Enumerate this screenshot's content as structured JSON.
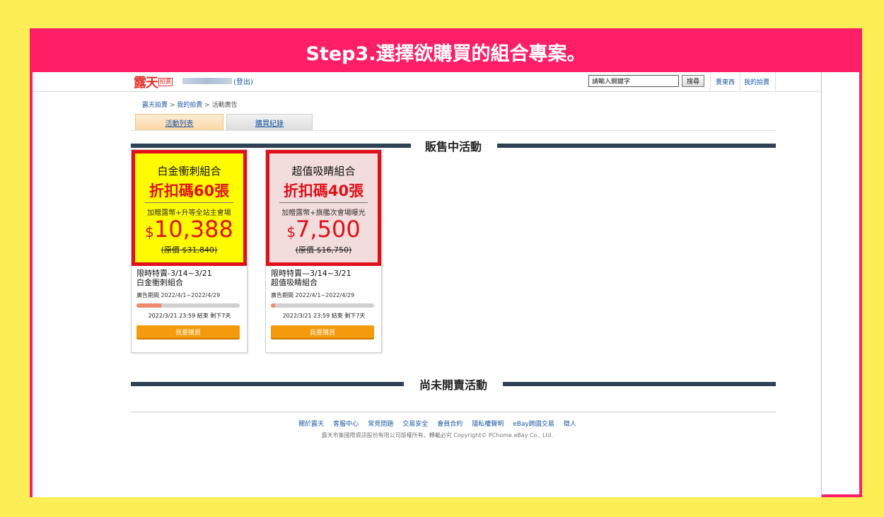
{
  "banner": {
    "title": "Step3.選擇欲購買的組合專案。"
  },
  "header": {
    "logo_text": "露天",
    "logo_sub": "拍賣",
    "logout": "(登出)",
    "search_placeholder": "請輸入關鍵字",
    "search_button": "搜尋",
    "link_sell": "賣東西",
    "link_my": "我的拍賣"
  },
  "breadcrumb": {
    "home": "露天拍賣",
    "sep1": " > ",
    "my": "我的拍賣",
    "sep2": " > ",
    "current": "活動廣告"
  },
  "tabs": [
    {
      "label": "活動列表"
    },
    {
      "label": "購買紀錄"
    }
  ],
  "sections": {
    "on_sale": "販售中活動",
    "upcoming": "尚未開賣活動"
  },
  "cards": [
    {
      "name": "白金衝刺組合",
      "code": "折扣碼60張",
      "gift": "加贈露幣+升等全站主會場",
      "currency": "$",
      "price": "10,388",
      "original": "(原價 $31,840)",
      "title_line1": "限時特賣-3/14~3/21",
      "title_line2": "白金衝刺組合",
      "period": "廣告期間  2022/4/1~2022/4/29",
      "progress": 0.24,
      "end": "2022/3/21  23:59  結束  剩下7天",
      "button": "我要購買",
      "bg": "#fffb00"
    },
    {
      "name": "超值吸睛組合",
      "code": "折扣碼40張",
      "gift": "加贈露幣+旗艦次會場曝光",
      "currency": "$",
      "price": "7,500",
      "original": "(原價 $16,750)",
      "title_line1": "限時特賣—3/14~3/21",
      "title_line2": "超值吸睛組合",
      "period": "廣告期間  2022/4/1~2022/4/29",
      "progress": 0.04,
      "end": "2022/3/21  23:59  結束  剩下7天",
      "button": "我要購買",
      "bg": "#f3dcdc"
    }
  ],
  "footer": {
    "links": [
      "關於露天",
      "客服中心",
      "常見問題",
      "交易安全",
      "會員合約",
      "隱私權聲明",
      "eBay跨國交易",
      "徵人"
    ],
    "copyright": "露天市集國際資訊股份有限公司版權所有，轉載必究 Copyright©   PChome eBay Co., Ltd."
  },
  "colors": {
    "banner": "#ff1f66",
    "background": "#fdee55",
    "promo_border": "#e0101a",
    "button": "#f49a0c"
  }
}
